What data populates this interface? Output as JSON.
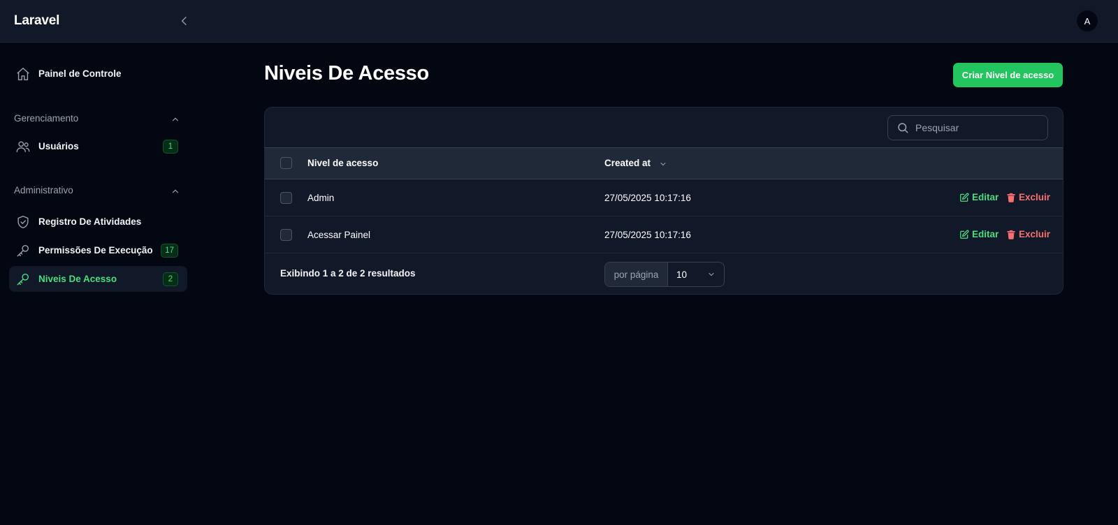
{
  "app": {
    "brand": "Laravel",
    "user_initial": "A"
  },
  "sidebar": {
    "dashboard": {
      "label": "Painel de Controle"
    },
    "groups": [
      {
        "title": "Gerenciamento",
        "items": [
          {
            "label": "Usuários",
            "badge": "1"
          }
        ]
      },
      {
        "title": "Administrativo",
        "items": [
          {
            "label": "Registro De Atividades"
          },
          {
            "label": "Permissões De Execução",
            "badge": "17"
          },
          {
            "label": "Niveis De Acesso",
            "badge": "2",
            "active": true
          }
        ]
      }
    ]
  },
  "page": {
    "title": "Niveis De Acesso",
    "create_button": "Criar Nivel de acesso"
  },
  "table": {
    "search_placeholder": "Pesquisar",
    "columns": {
      "name": "Nivel de acesso",
      "created": "Created at"
    },
    "rows": [
      {
        "name": "Admin",
        "created": "27/05/2025 10:17:16"
      },
      {
        "name": "Acessar Painel",
        "created": "27/05/2025 10:17:16"
      }
    ],
    "actions": {
      "edit": "Editar",
      "delete": "Excluir"
    },
    "footer": {
      "summary": "Exibindo 1 a 2 de 2 resultados",
      "per_page_label": "por página",
      "per_page_value": "10"
    }
  },
  "colors": {
    "background": "#030712",
    "panel": "#111827",
    "accent": "#22c55e",
    "accent_text": "#4ade80",
    "danger": "#f87171"
  }
}
